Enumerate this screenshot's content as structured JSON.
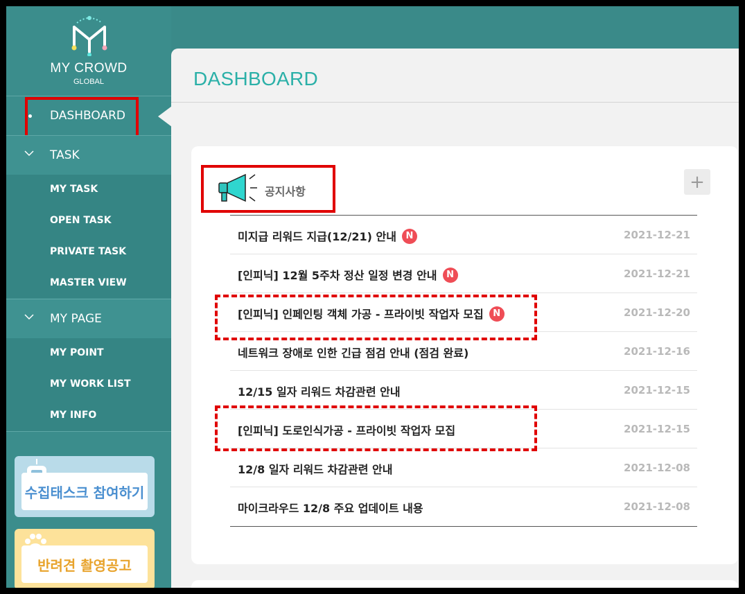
{
  "brand": {
    "name": "MY CROWD",
    "sub": "GLOBAL"
  },
  "sidebar": {
    "dashboard": "DASHBOARD",
    "task": {
      "label": "TASK",
      "items": [
        "MY TASK",
        "OPEN TASK",
        "PRIVATE TASK",
        "MASTER VIEW"
      ]
    },
    "mypage": {
      "label": "MY PAGE",
      "items": [
        "MY POINT",
        "MY WORK LIST",
        "MY INFO"
      ]
    },
    "banners": [
      {
        "label": "수집태스크 참여하기",
        "color": "#4a8fd0",
        "bg": "#b9dbe9"
      },
      {
        "label": "반려견 촬영공고",
        "color": "#e8a32b",
        "bg": "#fde29a"
      }
    ]
  },
  "main": {
    "title": "DASHBOARD",
    "notice": {
      "title": "공지사항",
      "plus": "+",
      "new_badge": "N",
      "rows": [
        {
          "title": "미지급 리워드 지급(12/21) 안내",
          "date": "2021-12-21",
          "new": true
        },
        {
          "title": "[인피닉] 12월 5주차 정산 일정 변경 안내",
          "date": "2021-12-21",
          "new": true
        },
        {
          "title": "[인피닉] 인페인팅 객체 가공 - 프라이빗 작업자 모집",
          "date": "2021-12-20",
          "new": true
        },
        {
          "title": "네트워크 장애로 인한 긴급 점검 안내 (점검 완료)",
          "date": "2021-12-16",
          "new": false
        },
        {
          "title": "12/15 일자 리워드 차감관련 안내",
          "date": "2021-12-15",
          "new": false
        },
        {
          "title": "[인피닉] 도로인식가공 - 프라이빗 작업자 모집",
          "date": "2021-12-15",
          "new": false
        },
        {
          "title": "12/8 일자 리워드 차감관련 안내",
          "date": "2021-12-08",
          "new": false
        },
        {
          "title": "마이크라우드 12/8 주요 업데이트 내용",
          "date": "2021-12-08",
          "new": false
        }
      ]
    }
  },
  "colors": {
    "sidebar": "#3b8d8c",
    "accent": "#2bb0a8",
    "badge": "#ef4d56",
    "highlight": "#e00000"
  }
}
